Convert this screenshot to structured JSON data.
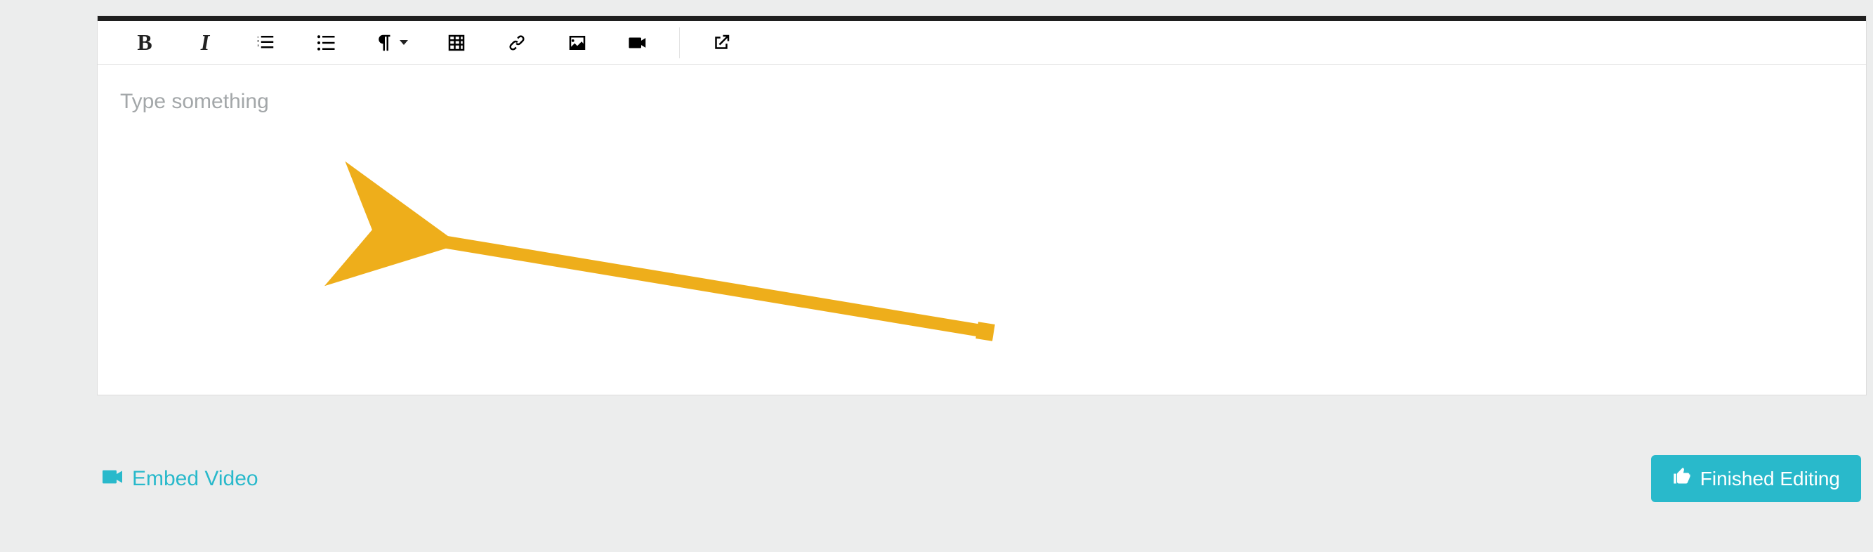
{
  "toolbar": {
    "bold_glyph": "B",
    "italic_glyph": "I"
  },
  "editor": {
    "placeholder": "Type something"
  },
  "footer": {
    "embed_label": "Embed Video",
    "finish_label": "Finished Editing"
  },
  "annotation": {
    "arrow_color": "#eeae1b"
  }
}
